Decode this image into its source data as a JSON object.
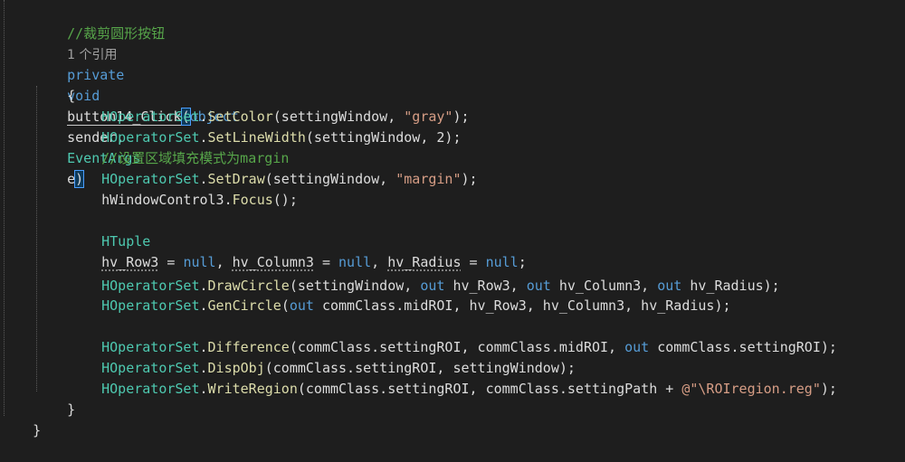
{
  "editor": {
    "comment_title": "//裁剪圆形按钮",
    "references": "1 个引用",
    "method": {
      "access": "private",
      "ret": "void",
      "name": "button14_Click",
      "open_paren": "(",
      "p1_type": "object",
      "p1_name": "sender",
      "comma": ",",
      "p2_type": "EventArgs",
      "p2_name": "e",
      "close_paren": ")"
    },
    "open_brace": "{",
    "close_brace": "}",
    "outer_close_brace": "}",
    "lines": {
      "l1": {
        "cls": "HOperatorSet",
        "fn": "SetColor",
        "a": "(settingWindow, ",
        "s": "\"gray\"",
        "b": ");"
      },
      "l2": {
        "cls": "HOperatorSet",
        "fn": "SetLineWidth",
        "a": "(settingWindow, 2);"
      },
      "l3": {
        "comment": "//设置区域填充模式为margin"
      },
      "l4": {
        "cls": "HOperatorSet",
        "fn": "SetDraw",
        "a": "(settingWindow, ",
        "s": "\"margin\"",
        "b": ");"
      },
      "l5": {
        "text": "hWindowControl3.",
        "fn": "Focus",
        "b": "();"
      },
      "l6": {
        "type": "HTuple",
        "v1": "hv_Row3",
        "eq1": " = ",
        "n1": "null",
        "c1": ", ",
        "v2": "hv_Column3",
        "eq2": " = ",
        "n2": "null",
        "c2": ", ",
        "v3": "hv_Radius",
        "eq3": " = ",
        "n3": "null",
        "end": ";"
      },
      "l7": {
        "cls": "HOperatorSet",
        "fn": "DrawCircle",
        "a": "(settingWindow, ",
        "o1": "out",
        "x1": " hv_Row3, ",
        "o2": "out",
        "x2": " hv_Column3, ",
        "o3": "out",
        "x3": " hv_Radius);"
      },
      "l8": {
        "cls": "HOperatorSet",
        "fn": "GenCircle",
        "a": "(",
        "o1": "out",
        "x1": " commClass.midROI, hv_Row3, hv_Column3, hv_Radius);"
      },
      "l9": {
        "cls": "HOperatorSet",
        "fn": "Difference",
        "a": "(commClass.settingROI, commClass.midROI, ",
        "o1": "out",
        "x1": " commClass.settingROI);"
      },
      "l10": {
        "cls": "HOperatorSet",
        "fn": "DispObj",
        "a": "(commClass.settingROI, settingWindow);"
      },
      "l11": {
        "cls": "HOperatorSet",
        "fn": "WriteRegion",
        "a": "(commClass.settingROI, commClass.settingPath + ",
        "s": "@\"\\ROIregion.reg\"",
        "b": ");"
      }
    }
  }
}
